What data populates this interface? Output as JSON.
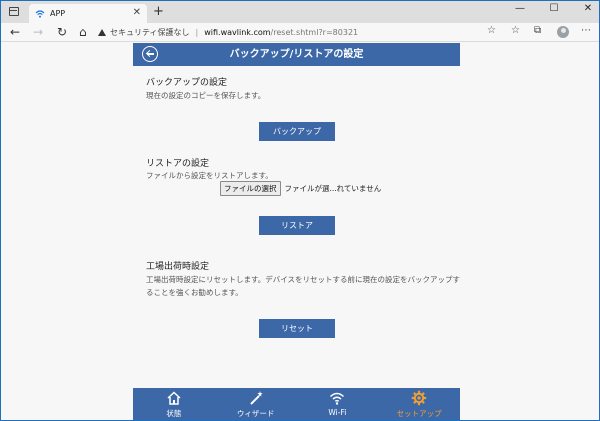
{
  "browser": {
    "tab_title": "APP",
    "tab_close": "✕",
    "new_tab": "+",
    "window_buttons": [
      "—",
      "☐",
      "✕"
    ],
    "nav": {
      "back": "←",
      "forward": "→",
      "reload": "↻",
      "home": "⌂"
    },
    "address": {
      "security_label": "セキュリティ保護なし",
      "separator": "|",
      "host": "wifi.wavlink.com",
      "path": "/reset.shtml?r=80321"
    },
    "toolbar_icons": [
      "☆",
      "☆",
      "⧉"
    ],
    "menu": "⋯"
  },
  "page": {
    "title": "バックアップ/リストアの設定",
    "backup": {
      "title": "バックアップの設定",
      "description": "現在の設定のコピーを保存します。",
      "button": "バックアップ"
    },
    "restore": {
      "title": "リストアの設定",
      "description": "ファイルから設定をリストアします。",
      "file_button": "ファイルの選択",
      "file_status": "ファイルが選...れていません",
      "button": "リストア"
    },
    "factory": {
      "title": "工場出荷時設定",
      "description_line1": "工場出荷時設定にリセットします。デバイスをリセットする前に現在の設定をバックアップす",
      "description_line2": "ることを強くお勧めします。",
      "button": "リセット"
    }
  },
  "bottom_nav": {
    "items": [
      {
        "label": "状態",
        "icon": "home-icon"
      },
      {
        "label": "ウィザード",
        "icon": "wand-icon"
      },
      {
        "label": "Wi-Fi",
        "icon": "wifi-icon"
      },
      {
        "label": "セットアップ",
        "icon": "gear-icon",
        "active": true
      }
    ]
  },
  "colors": {
    "primary": "#3d68a8",
    "active_nav": "#f0a030",
    "background": "#f7f7f7"
  }
}
